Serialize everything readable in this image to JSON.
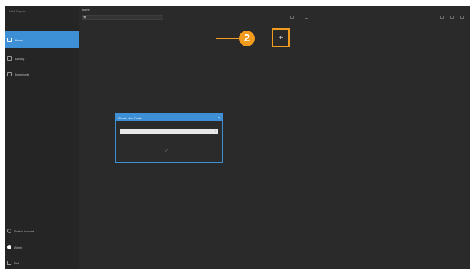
{
  "app": {
    "title": "NAS Explorer"
  },
  "sidebar": {
    "items": [
      {
        "label": "Home",
        "icon": "folder-icon"
      },
      {
        "label": "Backup",
        "icon": "backup-icon"
      },
      {
        "label": "Downloads",
        "icon": "download-icon"
      }
    ],
    "bottom": [
      {
        "label": "Switch Account",
        "icon": "key-icon"
      },
      {
        "label": "Admin",
        "icon": "user-icon"
      },
      {
        "label": "Exit",
        "icon": "exit-icon"
      }
    ]
  },
  "main": {
    "title": "Home",
    "path": "",
    "new_folder_icon": "plus-icon"
  },
  "callout": {
    "number": "2",
    "color": "#f29c1f"
  },
  "dialog": {
    "title": "Create New Folder",
    "input_value": "",
    "input_placeholder": "",
    "close_symbol": "×",
    "clear_symbol": "×",
    "confirm_symbol": "✓"
  },
  "colors": {
    "accent": "#3d8fd6",
    "callout": "#f29c1f",
    "background": "#2b2b2b"
  }
}
